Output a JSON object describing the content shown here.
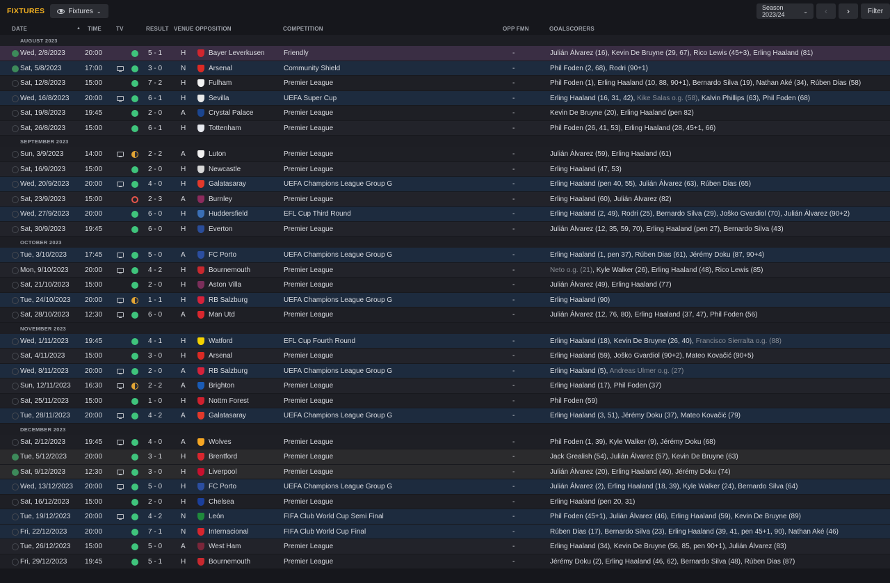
{
  "header": {
    "title": "FIXTURES",
    "view_label": "Fixtures",
    "season_label": "Season 2023/24",
    "filter_label": "Filter"
  },
  "columns": {
    "date": "DATE",
    "time": "TIME",
    "tv": "TV",
    "result": "RESULT",
    "venue": "VENUE",
    "opposition": "OPPOSITION",
    "competition": "COMPETITION",
    "opp_fmn": "OPP FMN",
    "goalscorers": "GOALSCORERS"
  },
  "colors": {
    "accent": "#f4b120",
    "win": "#3fc47c",
    "draw": "#e2a535",
    "loss": "#e5554b",
    "row_highlight": "#1d2b3e"
  },
  "rows": [
    {
      "kind": "month",
      "label": "AUGUST 2023"
    },
    {
      "date": "Wed, 2/8/2023",
      "time": "20:00",
      "tv": false,
      "outcome": "win",
      "result": "5 - 1",
      "venue": "H",
      "opp": "Bayer Leverkusen",
      "crest": "#d2262e",
      "comp": "Friendly",
      "fmn": "-",
      "scorers": "Julián Álvarez (16), Kevin De Bruyne (29, 67), Rico Lewis (45+3), Erling Haaland (81)",
      "hl": "purple",
      "done": true
    },
    {
      "date": "Sat, 5/8/2023",
      "time": "17:00",
      "tv": true,
      "outcome": "win",
      "result": "3 - 0",
      "venue": "N",
      "opp": "Arsenal",
      "crest": "#db2a24",
      "comp": "Community Shield",
      "fmn": "-",
      "scorers": "Phil Foden (2, 68), Rodri (90+1)",
      "hl": "blue",
      "done": true
    },
    {
      "date": "Sat, 12/8/2023",
      "time": "15:00",
      "tv": false,
      "outcome": "win",
      "result": "7 - 2",
      "venue": "H",
      "opp": "Fulham",
      "crest": "#f2f2f2",
      "comp": "Premier League",
      "fmn": "-",
      "scorers": "Phil Foden (1), Erling Haaland (10, 88, 90+1), Bernardo Silva (19), Nathan Aké (34), Rúben Dias (58)",
      "hl": "",
      "done": false
    },
    {
      "date": "Wed, 16/8/2023",
      "time": "20:00",
      "tv": true,
      "outcome": "win",
      "result": "6 - 1",
      "venue": "H",
      "opp": "Sevilla",
      "crest": "#e8e8e8",
      "comp": "UEFA Super Cup",
      "fmn": "-",
      "scorers": "Erling Haaland (16, 31, 42), ",
      "og": "Kike Salas o.g. (58)",
      "scorers2": ", Kalvin Phillips (63), Phil Foden (68)",
      "hl": "blue",
      "done": false
    },
    {
      "date": "Sat, 19/8/2023",
      "time": "19:45",
      "tv": false,
      "outcome": "win",
      "result": "2 - 0",
      "venue": "A",
      "opp": "Crystal Palace",
      "crest": "#1b458f",
      "comp": "Premier League",
      "fmn": "-",
      "scorers": "Kevin De Bruyne (20), Erling Haaland (pen 82)",
      "hl": "",
      "done": false
    },
    {
      "date": "Sat, 26/8/2023",
      "time": "15:00",
      "tv": false,
      "outcome": "win",
      "result": "6 - 1",
      "venue": "H",
      "opp": "Tottenham",
      "crest": "#e6e8ee",
      "comp": "Premier League",
      "fmn": "-",
      "scorers": "Phil Foden (26, 41, 53), Erling Haaland (28, 45+1, 66)",
      "hl": "",
      "done": false
    },
    {
      "kind": "month",
      "label": "SEPTEMBER 2023"
    },
    {
      "date": "Sun, 3/9/2023",
      "time": "14:00",
      "tv": true,
      "outcome": "draw",
      "result": "2 - 2",
      "venue": "A",
      "opp": "Luton",
      "crest": "#f2f2f2",
      "comp": "Premier League",
      "fmn": "-",
      "scorers": "Julián Álvarez (59), Erling Haaland (61)",
      "hl": "",
      "done": false
    },
    {
      "date": "Sat, 16/9/2023",
      "time": "15:00",
      "tv": false,
      "outcome": "win",
      "result": "2 - 0",
      "venue": "H",
      "opp": "Newcastle",
      "crest": "#d9d9d9",
      "comp": "Premier League",
      "fmn": "-",
      "scorers": "Erling Haaland (47, 53)",
      "hl": "",
      "done": false
    },
    {
      "date": "Wed, 20/9/2023",
      "time": "20:00",
      "tv": true,
      "outcome": "win",
      "result": "4 - 0",
      "venue": "H",
      "opp": "Galatasaray",
      "crest": "#e2392b",
      "comp": "UEFA Champions League Group G",
      "fmn": "-",
      "scorers": "Erling Haaland (pen 40, 55), Julián Álvarez (63), Rúben Dias (65)",
      "hl": "blue",
      "done": false
    },
    {
      "date": "Sat, 23/9/2023",
      "time": "15:00",
      "tv": false,
      "outcome": "loss",
      "result": "2 - 3",
      "venue": "A",
      "opp": "Burnley",
      "crest": "#8c2b5d",
      "comp": "Premier League",
      "fmn": "-",
      "scorers": "Erling Haaland (60), Julián Álvarez (82)",
      "hl": "",
      "done": false
    },
    {
      "date": "Wed, 27/9/2023",
      "time": "20:00",
      "tv": false,
      "outcome": "win",
      "result": "6 - 0",
      "venue": "H",
      "opp": "Huddersfield",
      "crest": "#3a6fb5",
      "comp": "EFL Cup Third Round",
      "fmn": "-",
      "scorers": "Erling Haaland (2, 49), Rodri (25), Bernardo Silva (29), Joško Gvardiol (70), Julián Álvarez (90+2)",
      "hl": "blue",
      "done": false
    },
    {
      "date": "Sat, 30/9/2023",
      "time": "19:45",
      "tv": false,
      "outcome": "win",
      "result": "6 - 0",
      "venue": "H",
      "opp": "Everton",
      "crest": "#2a4d9a",
      "comp": "Premier League",
      "fmn": "-",
      "scorers": "Julián Álvarez (12, 35, 59, 70), Erling Haaland (pen 27), Bernardo Silva (43)",
      "hl": "",
      "done": false
    },
    {
      "kind": "month",
      "label": "OCTOBER 2023"
    },
    {
      "date": "Tue, 3/10/2023",
      "time": "17:45",
      "tv": true,
      "outcome": "win",
      "result": "5 - 0",
      "venue": "A",
      "opp": "FC Porto",
      "crest": "#2b4ea0",
      "comp": "UEFA Champions League Group G",
      "fmn": "-",
      "scorers": "Erling Haaland (1, pen 37), Rúben Dias (61), Jérémy Doku (87, 90+4)",
      "hl": "blue",
      "done": false
    },
    {
      "date": "Mon, 9/10/2023",
      "time": "20:00",
      "tv": true,
      "outcome": "win",
      "result": "4 - 2",
      "venue": "H",
      "opp": "Bournemouth",
      "crest": "#c8282e",
      "comp": "Premier League",
      "fmn": "-",
      "scorers": "",
      "og": "Neto o.g. (21)",
      "scorers2": ", Kyle Walker (26), Erling Haaland (48), Rico Lewis (85)",
      "hl": "",
      "done": false
    },
    {
      "date": "Sat, 21/10/2023",
      "time": "15:00",
      "tv": false,
      "outcome": "win",
      "result": "2 - 0",
      "venue": "H",
      "opp": "Aston Villa",
      "crest": "#7a2e5a",
      "comp": "Premier League",
      "fmn": "-",
      "scorers": "Julián Álvarez (49), Erling Haaland (77)",
      "hl": "",
      "done": false
    },
    {
      "date": "Tue, 24/10/2023",
      "time": "20:00",
      "tv": true,
      "outcome": "draw",
      "result": "1 - 1",
      "venue": "H",
      "opp": "RB Salzburg",
      "crest": "#d6223a",
      "comp": "UEFA Champions League Group G",
      "fmn": "-",
      "scorers": "Erling Haaland (90)",
      "hl": "blue",
      "done": false
    },
    {
      "date": "Sat, 28/10/2023",
      "time": "12:30",
      "tv": true,
      "outcome": "win",
      "result": "6 - 0",
      "venue": "A",
      "opp": "Man Utd",
      "crest": "#d9272e",
      "comp": "Premier League",
      "fmn": "-",
      "scorers": "Julián Álvarez (12, 76, 80), Erling Haaland (37, 47), Phil Foden (56)",
      "hl": "",
      "done": false
    },
    {
      "kind": "month",
      "label": "NOVEMBER 2023"
    },
    {
      "date": "Wed, 1/11/2023",
      "time": "19:45",
      "tv": false,
      "outcome": "win",
      "result": "4 - 1",
      "venue": "H",
      "opp": "Watford",
      "crest": "#f5d200",
      "comp": "EFL Cup Fourth Round",
      "fmn": "-",
      "scorers": "Erling Haaland (18), Kevin De Bruyne (26, 40), ",
      "og": "Francisco Sierralta o.g. (88)",
      "scorers2": "",
      "hl": "blue",
      "done": false
    },
    {
      "date": "Sat, 4/11/2023",
      "time": "15:00",
      "tv": false,
      "outcome": "win",
      "result": "3 - 0",
      "venue": "H",
      "opp": "Arsenal",
      "crest": "#db2a24",
      "comp": "Premier League",
      "fmn": "-",
      "scorers": "Erling Haaland (59), Joško Gvardiol (90+2), Mateo Kovačić (90+5)",
      "hl": "",
      "done": false
    },
    {
      "date": "Wed, 8/11/2023",
      "time": "20:00",
      "tv": true,
      "outcome": "win",
      "result": "2 - 0",
      "venue": "A",
      "opp": "RB Salzburg",
      "crest": "#d6223a",
      "comp": "UEFA Champions League Group G",
      "fmn": "-",
      "scorers": "Erling Haaland (5), ",
      "og": "Andreas Ulmer o.g. (27)",
      "scorers2": "",
      "hl": "blue",
      "done": false
    },
    {
      "date": "Sun, 12/11/2023",
      "time": "16:30",
      "tv": true,
      "outcome": "draw",
      "result": "2 - 2",
      "venue": "A",
      "opp": "Brighton",
      "crest": "#1a5bb5",
      "comp": "Premier League",
      "fmn": "-",
      "scorers": "Erling Haaland (17), Phil Foden (37)",
      "hl": "",
      "done": false
    },
    {
      "date": "Sat, 25/11/2023",
      "time": "15:00",
      "tv": false,
      "outcome": "win",
      "result": "1 - 0",
      "venue": "H",
      "opp": "Nottm Forest",
      "crest": "#d0202e",
      "comp": "Premier League",
      "fmn": "-",
      "scorers": "Phil Foden (59)",
      "hl": "",
      "done": false
    },
    {
      "date": "Tue, 28/11/2023",
      "time": "20:00",
      "tv": true,
      "outcome": "win",
      "result": "4 - 2",
      "venue": "A",
      "opp": "Galatasaray",
      "crest": "#e2392b",
      "comp": "UEFA Champions League Group G",
      "fmn": "-",
      "scorers": "Erling Haaland (3, 51), Jérémy Doku (37), Mateo Kovačić (79)",
      "hl": "blue",
      "done": false
    },
    {
      "kind": "month",
      "label": "DECEMBER 2023"
    },
    {
      "date": "Sat, 2/12/2023",
      "time": "19:45",
      "tv": true,
      "outcome": "win",
      "result": "4 - 0",
      "venue": "A",
      "opp": "Wolves",
      "crest": "#f5a623",
      "comp": "Premier League",
      "fmn": "-",
      "scorers": "Phil Foden (1, 39), Kyle Walker (9), Jérémy Doku (68)",
      "hl": "",
      "done": false
    },
    {
      "date": "Tue, 5/12/2023",
      "time": "20:00",
      "tv": false,
      "outcome": "win",
      "result": "3 - 1",
      "venue": "H",
      "opp": "Brentford",
      "crest": "#d8262e",
      "comp": "Premier League",
      "fmn": "-",
      "scorers": "Jack Grealish (54), Julián Álvarez (57), Kevin De Bruyne (63)",
      "hl": "grey",
      "done": true
    },
    {
      "date": "Sat, 9/12/2023",
      "time": "12:30",
      "tv": true,
      "outcome": "win",
      "result": "3 - 0",
      "venue": "H",
      "opp": "Liverpool",
      "crest": "#c8102e",
      "comp": "Premier League",
      "fmn": "-",
      "scorers": "Julián Álvarez (20), Erling Haaland (40), Jérémy Doku (74)",
      "hl": "grey",
      "done": true
    },
    {
      "date": "Wed, 13/12/2023",
      "time": "20:00",
      "tv": true,
      "outcome": "win",
      "result": "5 - 0",
      "venue": "H",
      "opp": "FC Porto",
      "crest": "#2b4ea0",
      "comp": "UEFA Champions League Group G",
      "fmn": "-",
      "scorers": "Julián Álvarez (2), Erling Haaland (18, 39), Kyle Walker (24), Bernardo Silva (64)",
      "hl": "blue",
      "done": false
    },
    {
      "date": "Sat, 16/12/2023",
      "time": "15:00",
      "tv": false,
      "outcome": "win",
      "result": "2 - 0",
      "venue": "H",
      "opp": "Chelsea",
      "crest": "#1b3f9b",
      "comp": "Premier League",
      "fmn": "-",
      "scorers": "Erling Haaland (pen 20, 31)",
      "hl": "",
      "done": false
    },
    {
      "date": "Tue, 19/12/2023",
      "time": "20:00",
      "tv": true,
      "outcome": "win",
      "result": "4 - 2",
      "venue": "N",
      "opp": "León",
      "crest": "#1f8a3c",
      "comp": "FIFA Club World Cup Semi Final",
      "fmn": "-",
      "scorers": "Phil Foden (45+1), Julián Álvarez (46), Erling Haaland (59), Kevin De Bruyne (89)",
      "hl": "blue",
      "done": false
    },
    {
      "date": "Fri, 22/12/2023",
      "time": "20:00",
      "tv": false,
      "outcome": "win",
      "result": "7 - 1",
      "venue": "N",
      "opp": "Internacional",
      "crest": "#d6262e",
      "comp": "FIFA Club World Cup Final",
      "fmn": "-",
      "scorers": "Rúben Dias (17), Bernardo Silva (23), Erling Haaland (39, 41, pen 45+1, 90), Nathan Aké (46)",
      "hl": "blue",
      "done": false
    },
    {
      "date": "Tue, 26/12/2023",
      "time": "15:00",
      "tv": false,
      "outcome": "win",
      "result": "5 - 0",
      "venue": "A",
      "opp": "West Ham",
      "crest": "#7a263a",
      "comp": "Premier League",
      "fmn": "-",
      "scorers": "Erling Haaland (34), Kevin De Bruyne (56, 85, pen 90+1), Julián Álvarez (83)",
      "hl": "",
      "done": false
    },
    {
      "date": "Fri, 29/12/2023",
      "time": "19:45",
      "tv": false,
      "outcome": "win",
      "result": "5 - 1",
      "venue": "H",
      "opp": "Bournemouth",
      "crest": "#c8282e",
      "comp": "Premier League",
      "fmn": "-",
      "scorers": "Jérémy Doku (2), Erling Haaland (46, 62), Bernardo Silva (48), Rúben Dias (87)",
      "hl": "",
      "done": false
    }
  ]
}
